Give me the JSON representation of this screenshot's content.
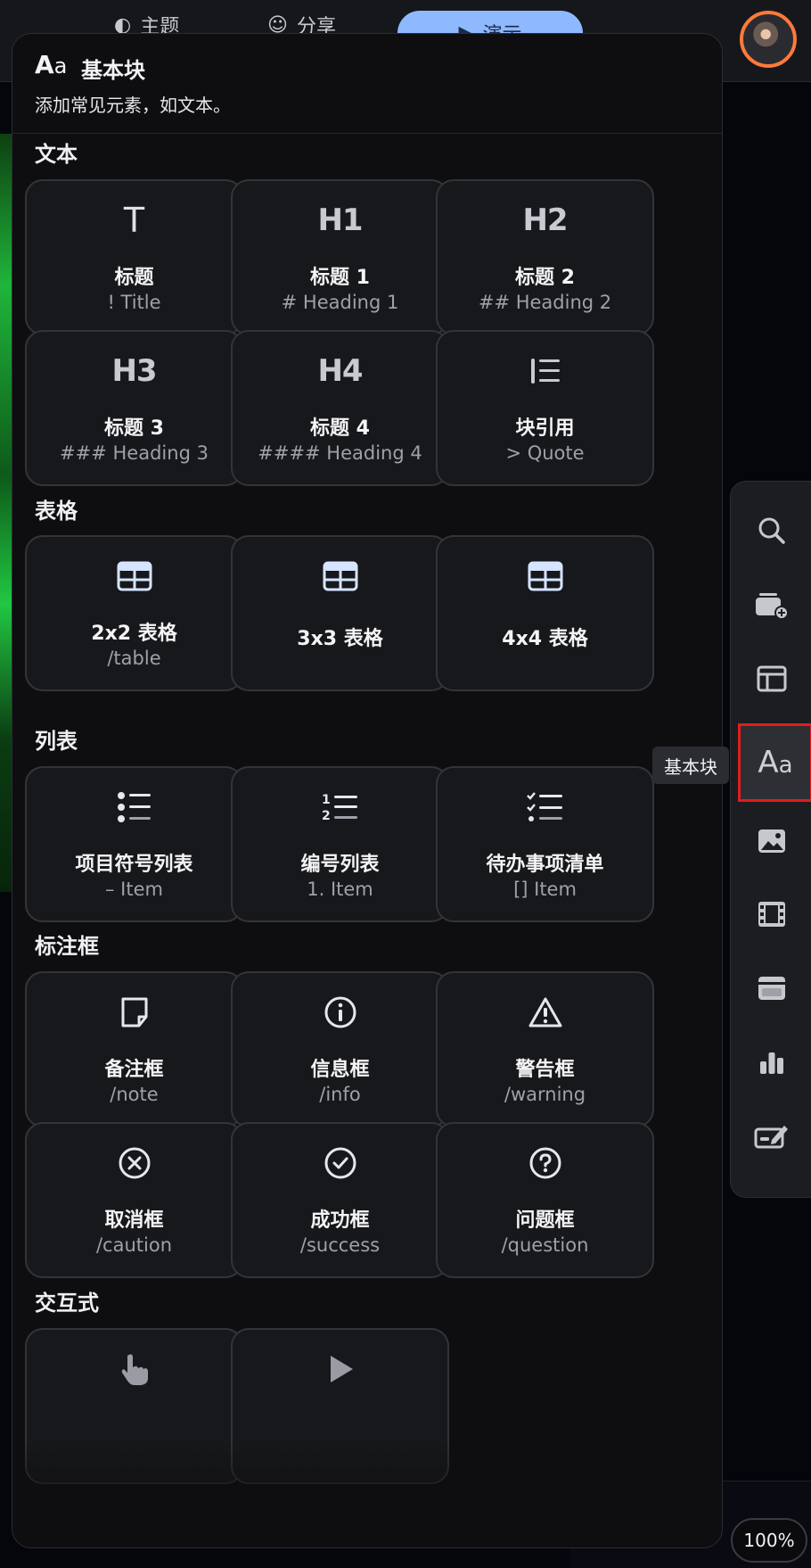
{
  "topbar": {
    "tabs": [
      {
        "label": "主题",
        "icon": "palette-icon"
      },
      {
        "label": "分享",
        "icon": "people-icon"
      }
    ],
    "present_label": "演示",
    "avatar": "avatar"
  },
  "panel": {
    "title": "基本块",
    "subtitle": "添加常见元素，如文本。",
    "icon_text": "A",
    "icon_text_small": "a"
  },
  "sections": {
    "text": {
      "title": "文本",
      "cards": [
        {
          "icon": "T",
          "label": "标题",
          "hint": "! Title"
        },
        {
          "icon": "H1",
          "label": "标题 1",
          "hint": "# Heading 1"
        },
        {
          "icon": "H2",
          "label": "标题 2",
          "hint": "## Heading 2"
        },
        {
          "icon": "H3",
          "label": "标题 3",
          "hint": "### Heading 3"
        },
        {
          "icon": "H4",
          "label": "标题 4",
          "hint": "#### Heading 4"
        },
        {
          "icon": "quote-icon",
          "label": "块引用",
          "hint": "> Quote"
        }
      ]
    },
    "table": {
      "title": "表格",
      "cards": [
        {
          "icon": "table-icon",
          "label": "2x2 表格",
          "hint": "/table"
        },
        {
          "icon": "table-icon",
          "label": "3x3 表格",
          "hint": ""
        },
        {
          "icon": "table-icon",
          "label": "4x4 表格",
          "hint": ""
        }
      ]
    },
    "list": {
      "title": "列表",
      "cards": [
        {
          "icon": "bullet-list-icon",
          "label": "项目符号列表",
          "hint": "– Item"
        },
        {
          "icon": "numbered-list-icon",
          "label": "编号列表",
          "hint": "1. Item"
        },
        {
          "icon": "checklist-icon",
          "label": "待办事项清单",
          "hint": "[] Item"
        }
      ]
    },
    "callout": {
      "title": "标注框",
      "cards": [
        {
          "icon": "note-icon",
          "label": "备注框",
          "hint": "/note"
        },
        {
          "icon": "info-icon",
          "label": "信息框",
          "hint": "/info"
        },
        {
          "icon": "warning-icon",
          "label": "警告框",
          "hint": "/warning"
        },
        {
          "icon": "caution-icon",
          "label": "取消框",
          "hint": "/caution"
        },
        {
          "icon": "success-icon",
          "label": "成功框",
          "hint": "/success"
        },
        {
          "icon": "question-icon",
          "label": "问题框",
          "hint": "/question"
        }
      ]
    },
    "interactive": {
      "title": "交互式",
      "cards": [
        {
          "icon": "pointer-icon"
        },
        {
          "icon": "play-icon"
        }
      ]
    }
  },
  "toolbar": {
    "tooltip": "基本块",
    "aa_big": "A",
    "aa_small": "a",
    "tools": [
      "search-icon",
      "add-card-icon",
      "layout-icon",
      "basic-blocks-icon",
      "image-icon",
      "video-icon",
      "embed-icon",
      "chart-icon",
      "form-icon"
    ]
  },
  "zoom": "100%",
  "colors": {
    "panel_bg": "#0e0e10",
    "card_bg": "#17181b",
    "card_border": "#33343a",
    "present_button": "#8fb9ff",
    "active_outline": "#e11d1d",
    "avatar_ring": "#ff7a3a"
  }
}
